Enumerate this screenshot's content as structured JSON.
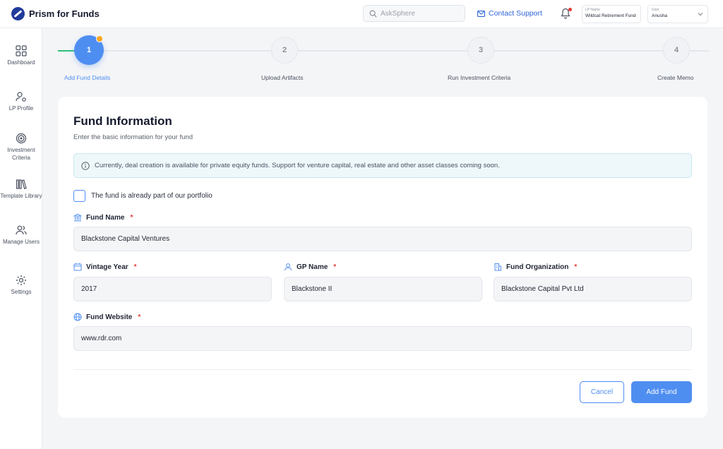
{
  "app": {
    "name": "Prism for Funds"
  },
  "header": {
    "search_placeholder": "AskSphere",
    "contact_label": "Contact Support",
    "lp_label": "LP Name",
    "lp_value": "Wildcat Retirement Fund",
    "user_label": "User",
    "user_value": "Anusha"
  },
  "sidebar": {
    "items": [
      {
        "label": "Dashboard",
        "icon": "grid-icon"
      },
      {
        "label": "LP Profile",
        "icon": "user-settings-icon"
      },
      {
        "label": "Investment Criteria",
        "icon": "target-icon"
      },
      {
        "label": "Template Library",
        "icon": "library-icon"
      },
      {
        "label": "Manage Users",
        "icon": "users-icon"
      },
      {
        "label": "Settings",
        "icon": "gear-icon"
      }
    ]
  },
  "stepper": {
    "steps": [
      {
        "num": "1",
        "label": "Add Fund Details",
        "active": true
      },
      {
        "num": "2",
        "label": "Upload Artifacts",
        "active": false
      },
      {
        "num": "3",
        "label": "Run Investment Criteria",
        "active": false
      },
      {
        "num": "4",
        "label": "Create Memo",
        "active": false
      }
    ]
  },
  "form": {
    "title": "Fund Information",
    "subtitle": "Enter the basic information for your fund",
    "info": "Currently, deal creation is available for  private equity funds. Support for venture capital, real estate and other asset classes coming soon.",
    "portfolio_checkbox_label": "The fund is already part of our portfolio",
    "fund_name_label": "Fund Name",
    "fund_name_value": "Blackstone Capital Ventures",
    "vintage_year_label": "Vintage Year",
    "vintage_year_value": "2017",
    "gp_name_label": "GP Name",
    "gp_name_value": "Blackstone II",
    "fund_org_label": "Fund Organization",
    "fund_org_value": "Blackstone Capital Pvt Ltd",
    "fund_website_label": "Fund Website",
    "fund_website_value": "www.rdr.com",
    "required_mark": "*",
    "cancel_label": "Cancel",
    "add_label": "Add Fund"
  },
  "colors": {
    "accent": "#4f8ef1",
    "progress": "#2fbf7a",
    "badge": "#f5a623",
    "required": "#e53935"
  }
}
